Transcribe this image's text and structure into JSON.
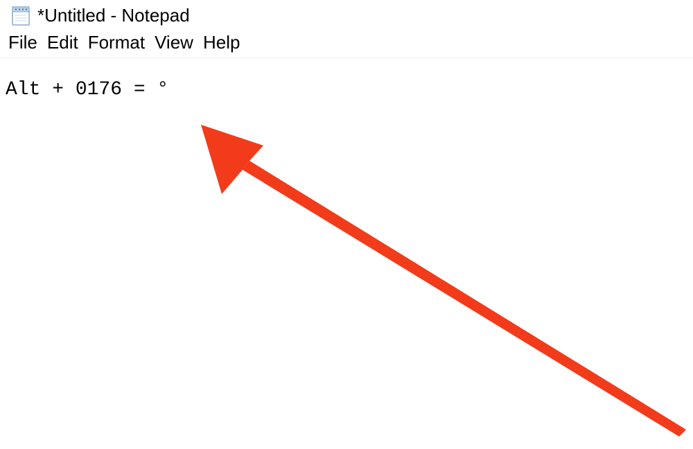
{
  "titlebar": {
    "title": "*Untitled - Notepad"
  },
  "menubar": {
    "items": [
      "File",
      "Edit",
      "Format",
      "View",
      "Help"
    ]
  },
  "editor": {
    "content": "Alt + 0176 = °"
  },
  "annotation": {
    "color": "#f23b1a"
  }
}
